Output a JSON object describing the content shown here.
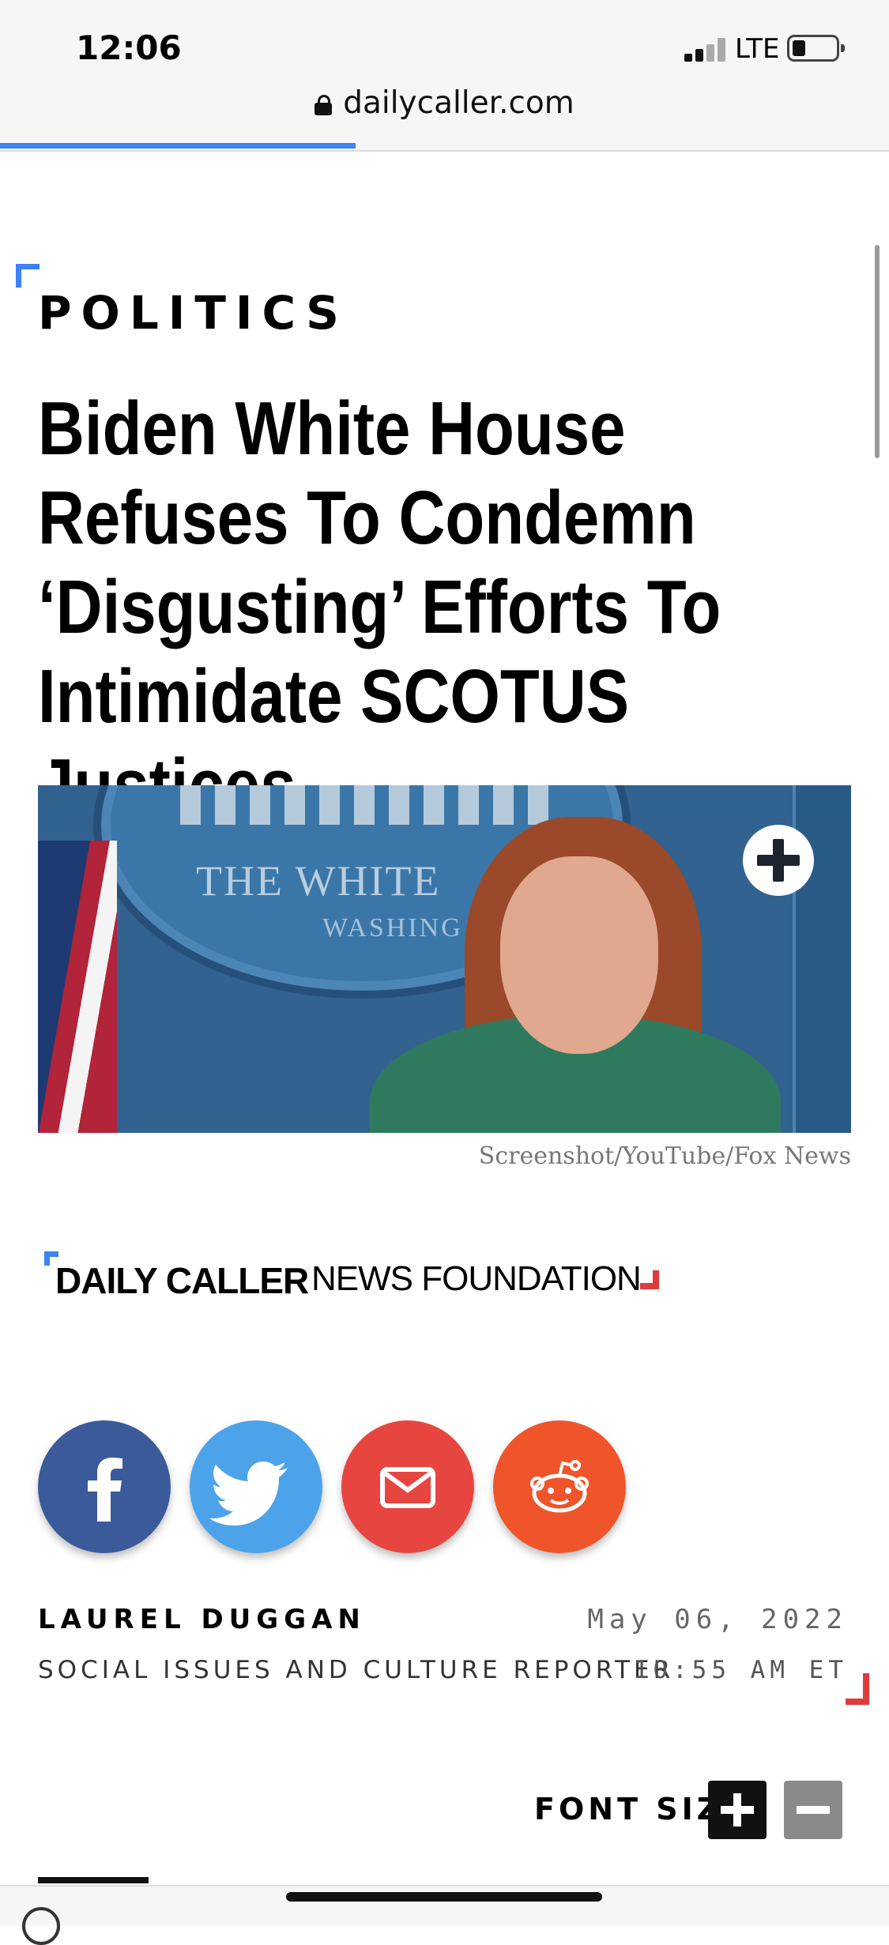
{
  "status_bar": {
    "time": "12:06",
    "network": "LTE"
  },
  "browser": {
    "url": "dailycaller.com",
    "load_progress_percent": 40
  },
  "article": {
    "category": "POLITICS",
    "headline": "Biden White House Refuses To Condemn ‘Disgusting’ Efforts To Intimidate SCOTUS Justices",
    "image": {
      "seal_text_1": "THE WHITE",
      "seal_text_2": "WASHING",
      "credit": "Screenshot/YouTube/Fox News"
    },
    "publisher": {
      "bold": "DAILY CALLER",
      "regular": "NEWS FOUNDATION"
    },
    "author": {
      "name": "LAUREL DUGGAN",
      "role": "SOCIAL ISSUES AND CULTURE REPORTER"
    },
    "date": "May 06, 2022",
    "time": "10:55 AM ET"
  },
  "share_buttons": [
    {
      "name": "facebook",
      "icon": "facebook-icon",
      "color": "#3b5a9a"
    },
    {
      "name": "twitter",
      "icon": "twitter-icon",
      "color": "#4da3ea"
    },
    {
      "name": "email",
      "icon": "mail-icon",
      "color": "#e6463f"
    },
    {
      "name": "reddit",
      "icon": "reddit-icon",
      "color": "#f0542a"
    }
  ],
  "font_size_control": {
    "label": "FONT SIZE:"
  },
  "colors": {
    "accent_blue": "#3b82f6",
    "accent_red": "#e03b3b"
  }
}
